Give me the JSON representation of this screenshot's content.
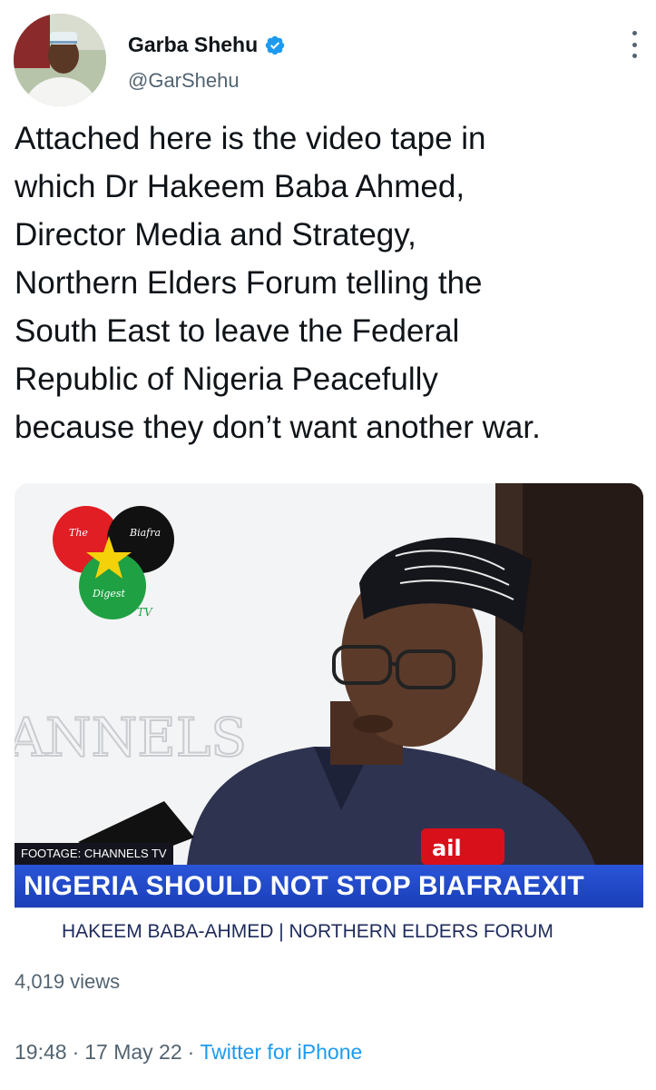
{
  "author": {
    "display_name": "Garba Shehu",
    "handle": "@GarShehu",
    "verified_icon": "verified-badge-icon"
  },
  "tweet": {
    "lines": [
      "Attached here is the video tape in",
      "which Dr Hakeem Baba Ahmed,",
      "Director Media and Strategy,",
      "Northern Elders Forum telling the",
      "South East to leave the Federal",
      "Republic of Nigeria Peacefully",
      "because they don’t want another war."
    ]
  },
  "media": {
    "logo": {
      "top": "The",
      "right": "Biafra",
      "bottom": "Digest",
      "tv": "TV"
    },
    "watermark": "ANNELS",
    "footage_label": "FOOTAGE: CHANNELS TV",
    "headline": "NIGERIA SHOULD NOT STOP BIAFRAEXIT",
    "subtitle": "HAKEEM BABA-AHMED | NORTHERN ELDERS FORUM"
  },
  "stats": {
    "views": "4,019 views"
  },
  "meta": {
    "time": "19:48",
    "date": "17 May 22",
    "separator": "·",
    "source": "Twitter for iPhone"
  },
  "colors": {
    "accent": "#1d9bf0",
    "secondary_text": "#536471",
    "headline_bar": "#2348c8"
  }
}
